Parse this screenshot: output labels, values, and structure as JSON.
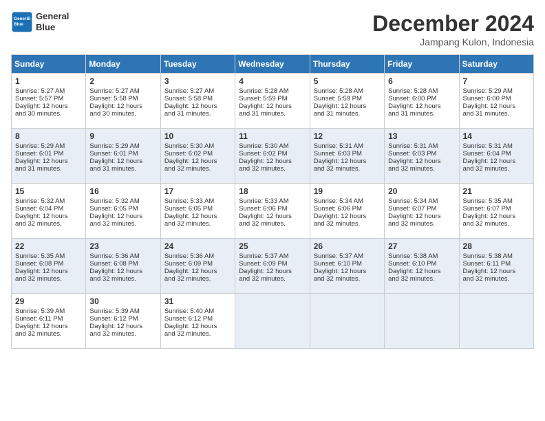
{
  "header": {
    "logo_line1": "General",
    "logo_line2": "Blue",
    "month": "December 2024",
    "location": "Jampang Kulon, Indonesia"
  },
  "weekdays": [
    "Sunday",
    "Monday",
    "Tuesday",
    "Wednesday",
    "Thursday",
    "Friday",
    "Saturday"
  ],
  "rows": [
    [
      {
        "day": "1",
        "lines": [
          "Sunrise: 5:27 AM",
          "Sunset: 5:57 PM",
          "Daylight: 12 hours",
          "and 30 minutes."
        ]
      },
      {
        "day": "2",
        "lines": [
          "Sunrise: 5:27 AM",
          "Sunset: 5:58 PM",
          "Daylight: 12 hours",
          "and 30 minutes."
        ]
      },
      {
        "day": "3",
        "lines": [
          "Sunrise: 5:27 AM",
          "Sunset: 5:58 PM",
          "Daylight: 12 hours",
          "and 31 minutes."
        ]
      },
      {
        "day": "4",
        "lines": [
          "Sunrise: 5:28 AM",
          "Sunset: 5:59 PM",
          "Daylight: 12 hours",
          "and 31 minutes."
        ]
      },
      {
        "day": "5",
        "lines": [
          "Sunrise: 5:28 AM",
          "Sunset: 5:59 PM",
          "Daylight: 12 hours",
          "and 31 minutes."
        ]
      },
      {
        "day": "6",
        "lines": [
          "Sunrise: 5:28 AM",
          "Sunset: 6:00 PM",
          "Daylight: 12 hours",
          "and 31 minutes."
        ]
      },
      {
        "day": "7",
        "lines": [
          "Sunrise: 5:29 AM",
          "Sunset: 6:00 PM",
          "Daylight: 12 hours",
          "and 31 minutes."
        ]
      }
    ],
    [
      {
        "day": "8",
        "lines": [
          "Sunrise: 5:29 AM",
          "Sunset: 6:01 PM",
          "Daylight: 12 hours",
          "and 31 minutes."
        ]
      },
      {
        "day": "9",
        "lines": [
          "Sunrise: 5:29 AM",
          "Sunset: 6:01 PM",
          "Daylight: 12 hours",
          "and 31 minutes."
        ]
      },
      {
        "day": "10",
        "lines": [
          "Sunrise: 5:30 AM",
          "Sunset: 6:02 PM",
          "Daylight: 12 hours",
          "and 32 minutes."
        ]
      },
      {
        "day": "11",
        "lines": [
          "Sunrise: 5:30 AM",
          "Sunset: 6:02 PM",
          "Daylight: 12 hours",
          "and 32 minutes."
        ]
      },
      {
        "day": "12",
        "lines": [
          "Sunrise: 5:31 AM",
          "Sunset: 6:03 PM",
          "Daylight: 12 hours",
          "and 32 minutes."
        ]
      },
      {
        "day": "13",
        "lines": [
          "Sunrise: 5:31 AM",
          "Sunset: 6:03 PM",
          "Daylight: 12 hours",
          "and 32 minutes."
        ]
      },
      {
        "day": "14",
        "lines": [
          "Sunrise: 5:31 AM",
          "Sunset: 6:04 PM",
          "Daylight: 12 hours",
          "and 32 minutes."
        ]
      }
    ],
    [
      {
        "day": "15",
        "lines": [
          "Sunrise: 5:32 AM",
          "Sunset: 6:04 PM",
          "Daylight: 12 hours",
          "and 32 minutes."
        ]
      },
      {
        "day": "16",
        "lines": [
          "Sunrise: 5:32 AM",
          "Sunset: 6:05 PM",
          "Daylight: 12 hours",
          "and 32 minutes."
        ]
      },
      {
        "day": "17",
        "lines": [
          "Sunrise: 5:33 AM",
          "Sunset: 6:05 PM",
          "Daylight: 12 hours",
          "and 32 minutes."
        ]
      },
      {
        "day": "18",
        "lines": [
          "Sunrise: 5:33 AM",
          "Sunset: 6:06 PM",
          "Daylight: 12 hours",
          "and 32 minutes."
        ]
      },
      {
        "day": "19",
        "lines": [
          "Sunrise: 5:34 AM",
          "Sunset: 6:06 PM",
          "Daylight: 12 hours",
          "and 32 minutes."
        ]
      },
      {
        "day": "20",
        "lines": [
          "Sunrise: 5:34 AM",
          "Sunset: 6:07 PM",
          "Daylight: 12 hours",
          "and 32 minutes."
        ]
      },
      {
        "day": "21",
        "lines": [
          "Sunrise: 5:35 AM",
          "Sunset: 6:07 PM",
          "Daylight: 12 hours",
          "and 32 minutes."
        ]
      }
    ],
    [
      {
        "day": "22",
        "lines": [
          "Sunrise: 5:35 AM",
          "Sunset: 6:08 PM",
          "Daylight: 12 hours",
          "and 32 minutes."
        ]
      },
      {
        "day": "23",
        "lines": [
          "Sunrise: 5:36 AM",
          "Sunset: 6:08 PM",
          "Daylight: 12 hours",
          "and 32 minutes."
        ]
      },
      {
        "day": "24",
        "lines": [
          "Sunrise: 5:36 AM",
          "Sunset: 6:09 PM",
          "Daylight: 12 hours",
          "and 32 minutes."
        ]
      },
      {
        "day": "25",
        "lines": [
          "Sunrise: 5:37 AM",
          "Sunset: 6:09 PM",
          "Daylight: 12 hours",
          "and 32 minutes."
        ]
      },
      {
        "day": "26",
        "lines": [
          "Sunrise: 5:37 AM",
          "Sunset: 6:10 PM",
          "Daylight: 12 hours",
          "and 32 minutes."
        ]
      },
      {
        "day": "27",
        "lines": [
          "Sunrise: 5:38 AM",
          "Sunset: 6:10 PM",
          "Daylight: 12 hours",
          "and 32 minutes."
        ]
      },
      {
        "day": "28",
        "lines": [
          "Sunrise: 5:38 AM",
          "Sunset: 6:11 PM",
          "Daylight: 12 hours",
          "and 32 minutes."
        ]
      }
    ],
    [
      {
        "day": "29",
        "lines": [
          "Sunrise: 5:39 AM",
          "Sunset: 6:11 PM",
          "Daylight: 12 hours",
          "and 32 minutes."
        ]
      },
      {
        "day": "30",
        "lines": [
          "Sunrise: 5:39 AM",
          "Sunset: 6:12 PM",
          "Daylight: 12 hours",
          "and 32 minutes."
        ]
      },
      {
        "day": "31",
        "lines": [
          "Sunrise: 5:40 AM",
          "Sunset: 6:12 PM",
          "Daylight: 12 hours",
          "and 32 minutes."
        ]
      },
      null,
      null,
      null,
      null
    ]
  ],
  "row_shading": [
    false,
    true,
    false,
    true,
    false
  ]
}
